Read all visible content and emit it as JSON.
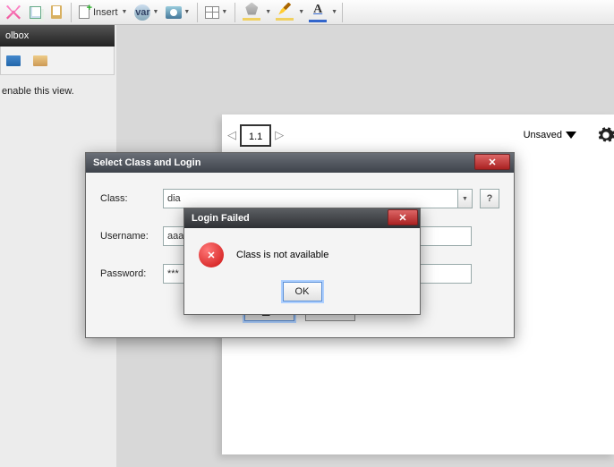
{
  "toolbar": {
    "insert_label": "Insert",
    "var_label": "var"
  },
  "leftpanel": {
    "title": "olbox",
    "enable_text": "enable this view."
  },
  "doc": {
    "tab_label": "1.1",
    "status": "Unsaved"
  },
  "dialog": {
    "title": "Select Class and Login",
    "class_label": "Class:",
    "class_value": "dia",
    "username_label": "Username:",
    "username_value": "aaa",
    "password_label": "Password:",
    "password_value": "***",
    "help_label": "?",
    "ok_label": "OK",
    "cancel_label": "Cancel"
  },
  "error": {
    "title": "Login Failed",
    "message": "Class is not available",
    "icon_glyph": "✕",
    "ok_label": "OK"
  }
}
